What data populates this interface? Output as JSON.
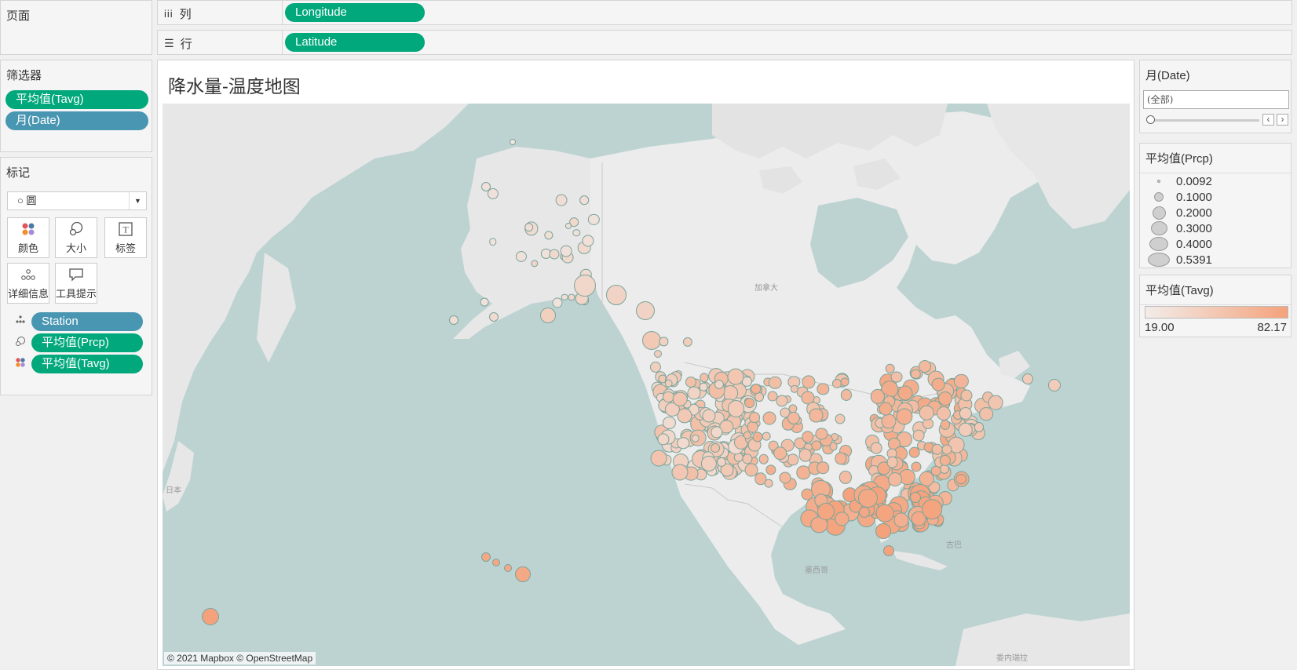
{
  "pages": {
    "title": "页面"
  },
  "shelves": {
    "columns": {
      "icon": "columns-icon",
      "label": "列",
      "pill": "Longitude"
    },
    "rows": {
      "icon": "rows-icon",
      "label": "行",
      "pill": "Latitude"
    }
  },
  "filters": {
    "title": "筛选器",
    "items": [
      "平均值(Tavg)",
      "月(Date)"
    ]
  },
  "marks": {
    "title": "标记",
    "type_label": "圆",
    "buttons": [
      {
        "label": "颜色",
        "icon": "color-icon"
      },
      {
        "label": "大小",
        "icon": "size-icon"
      },
      {
        "label": "标签",
        "icon": "label-icon"
      },
      {
        "label": "详细信息",
        "icon": "detail-icon"
      },
      {
        "label": "工具提示",
        "icon": "tooltip-icon"
      }
    ],
    "fields": [
      {
        "name": "Station",
        "icon": "detail-icon"
      },
      {
        "name": "平均值(Prcp)",
        "icon": "size-icon"
      },
      {
        "name": "平均值(Tavg)",
        "icon": "color-icon"
      }
    ]
  },
  "view": {
    "title": "降水量-温度地图",
    "map_labels": {
      "canada": "加拿大",
      "mexico": "墨西哥",
      "japan": "日本",
      "cuba": "古巴",
      "venezuela": "委内瑞拉"
    },
    "attribution": "© 2021 Mapbox © OpenStreetMap"
  },
  "date_filter": {
    "title": "月(Date)",
    "value": "(全部)"
  },
  "size_legend": {
    "title": "平均值(Prcp)",
    "items": [
      "0.0092",
      "0.1000",
      "0.2000",
      "0.3000",
      "0.4000",
      "0.5391"
    ]
  },
  "color_legend": {
    "title": "平均值(Tavg)",
    "min": "19.00",
    "max": "82.17",
    "color_low": "#f2ece8",
    "color_high": "#f4a27c"
  }
}
